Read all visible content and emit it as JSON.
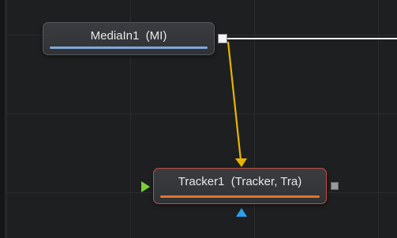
{
  "nodes": {
    "mediain": {
      "label": "MediaIn1  (MI)"
    },
    "tracker": {
      "label": "Tracker1  (Tracker, Tra)"
    }
  },
  "colors": {
    "background": "#1e1f21",
    "mediain_bar": "#7fa8d8",
    "tracker_bar": "#e0762c",
    "tracker_border": "#c0503e",
    "link_yellow": "#e8b400",
    "link_white": "#f0f0f0",
    "input_green": "#7bd037",
    "input_blue": "#2aa0e8"
  }
}
